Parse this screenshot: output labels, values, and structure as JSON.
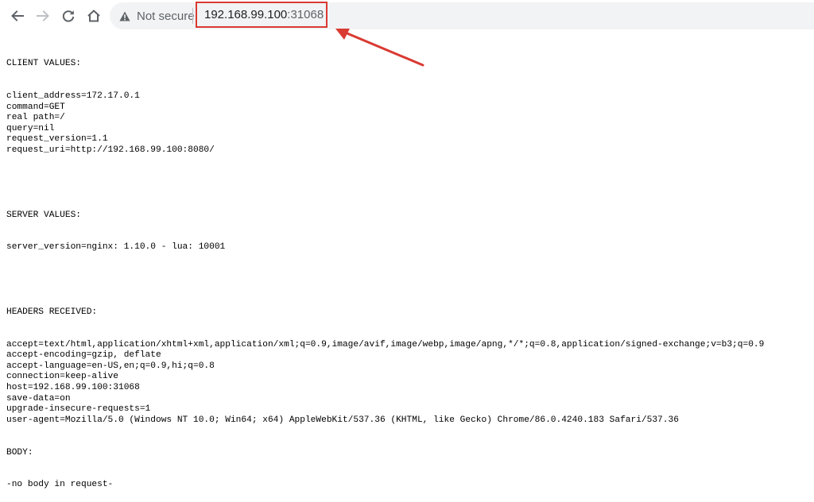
{
  "browser": {
    "security_label": "Not secure",
    "url_host": "192.168.99.100",
    "url_port": ":31068",
    "icons": {
      "back": "back-arrow-icon",
      "forward": "forward-arrow-icon",
      "reload": "reload-icon",
      "home": "home-icon",
      "security": "warning-triangle-icon"
    },
    "highlight_color": "#d93a32"
  },
  "page": {
    "client_header": "CLIENT VALUES:",
    "client_lines": [
      "client_address=172.17.0.1",
      "command=GET",
      "real path=/",
      "query=nil",
      "request_version=1.1",
      "request_uri=http://192.168.99.100:8080/"
    ],
    "server_header": "SERVER VALUES:",
    "server_lines": [
      "server_version=nginx: 1.10.0 - lua: 10001"
    ],
    "headers_header": "HEADERS RECEIVED:",
    "headers_lines": [
      "accept=text/html,application/xhtml+xml,application/xml;q=0.9,image/avif,image/webp,image/apng,*/*;q=0.8,application/signed-exchange;v=b3;q=0.9",
      "accept-encoding=gzip, deflate",
      "accept-language=en-US,en;q=0.9,hi;q=0.8",
      "connection=keep-alive",
      "host=192.168.99.100:31068",
      "save-data=on",
      "upgrade-insecure-requests=1",
      "user-agent=Mozilla/5.0 (Windows NT 10.0; Win64; x64) AppleWebKit/537.36 (KHTML, like Gecko) Chrome/86.0.4240.183 Safari/537.36"
    ],
    "body_header": "BODY:",
    "body_lines": [
      "-no body in request-"
    ]
  }
}
